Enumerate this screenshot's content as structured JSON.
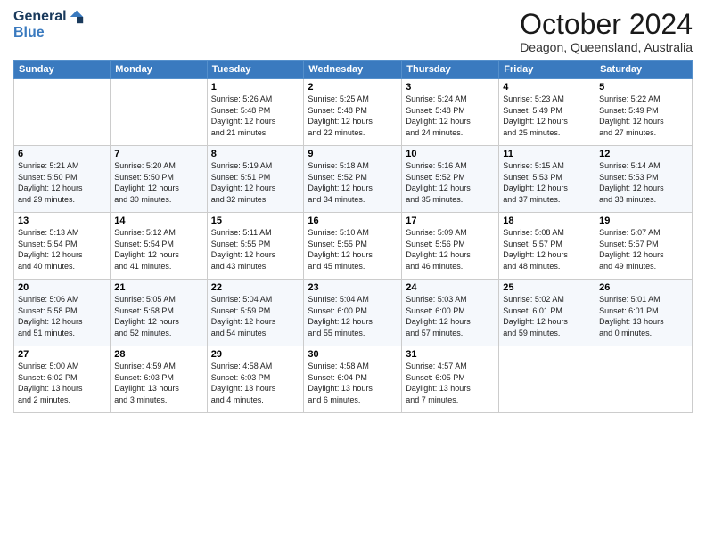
{
  "header": {
    "logo_general": "General",
    "logo_blue": "Blue",
    "month_title": "October 2024",
    "location": "Deagon, Queensland, Australia"
  },
  "days_of_week": [
    "Sunday",
    "Monday",
    "Tuesday",
    "Wednesday",
    "Thursday",
    "Friday",
    "Saturday"
  ],
  "weeks": [
    [
      {
        "day": "",
        "info": ""
      },
      {
        "day": "",
        "info": ""
      },
      {
        "day": "1",
        "info": "Sunrise: 5:26 AM\nSunset: 5:48 PM\nDaylight: 12 hours\nand 21 minutes."
      },
      {
        "day": "2",
        "info": "Sunrise: 5:25 AM\nSunset: 5:48 PM\nDaylight: 12 hours\nand 22 minutes."
      },
      {
        "day": "3",
        "info": "Sunrise: 5:24 AM\nSunset: 5:48 PM\nDaylight: 12 hours\nand 24 minutes."
      },
      {
        "day": "4",
        "info": "Sunrise: 5:23 AM\nSunset: 5:49 PM\nDaylight: 12 hours\nand 25 minutes."
      },
      {
        "day": "5",
        "info": "Sunrise: 5:22 AM\nSunset: 5:49 PM\nDaylight: 12 hours\nand 27 minutes."
      }
    ],
    [
      {
        "day": "6",
        "info": "Sunrise: 5:21 AM\nSunset: 5:50 PM\nDaylight: 12 hours\nand 29 minutes."
      },
      {
        "day": "7",
        "info": "Sunrise: 5:20 AM\nSunset: 5:50 PM\nDaylight: 12 hours\nand 30 minutes."
      },
      {
        "day": "8",
        "info": "Sunrise: 5:19 AM\nSunset: 5:51 PM\nDaylight: 12 hours\nand 32 minutes."
      },
      {
        "day": "9",
        "info": "Sunrise: 5:18 AM\nSunset: 5:52 PM\nDaylight: 12 hours\nand 34 minutes."
      },
      {
        "day": "10",
        "info": "Sunrise: 5:16 AM\nSunset: 5:52 PM\nDaylight: 12 hours\nand 35 minutes."
      },
      {
        "day": "11",
        "info": "Sunrise: 5:15 AM\nSunset: 5:53 PM\nDaylight: 12 hours\nand 37 minutes."
      },
      {
        "day": "12",
        "info": "Sunrise: 5:14 AM\nSunset: 5:53 PM\nDaylight: 12 hours\nand 38 minutes."
      }
    ],
    [
      {
        "day": "13",
        "info": "Sunrise: 5:13 AM\nSunset: 5:54 PM\nDaylight: 12 hours\nand 40 minutes."
      },
      {
        "day": "14",
        "info": "Sunrise: 5:12 AM\nSunset: 5:54 PM\nDaylight: 12 hours\nand 41 minutes."
      },
      {
        "day": "15",
        "info": "Sunrise: 5:11 AM\nSunset: 5:55 PM\nDaylight: 12 hours\nand 43 minutes."
      },
      {
        "day": "16",
        "info": "Sunrise: 5:10 AM\nSunset: 5:55 PM\nDaylight: 12 hours\nand 45 minutes."
      },
      {
        "day": "17",
        "info": "Sunrise: 5:09 AM\nSunset: 5:56 PM\nDaylight: 12 hours\nand 46 minutes."
      },
      {
        "day": "18",
        "info": "Sunrise: 5:08 AM\nSunset: 5:57 PM\nDaylight: 12 hours\nand 48 minutes."
      },
      {
        "day": "19",
        "info": "Sunrise: 5:07 AM\nSunset: 5:57 PM\nDaylight: 12 hours\nand 49 minutes."
      }
    ],
    [
      {
        "day": "20",
        "info": "Sunrise: 5:06 AM\nSunset: 5:58 PM\nDaylight: 12 hours\nand 51 minutes."
      },
      {
        "day": "21",
        "info": "Sunrise: 5:05 AM\nSunset: 5:58 PM\nDaylight: 12 hours\nand 52 minutes."
      },
      {
        "day": "22",
        "info": "Sunrise: 5:04 AM\nSunset: 5:59 PM\nDaylight: 12 hours\nand 54 minutes."
      },
      {
        "day": "23",
        "info": "Sunrise: 5:04 AM\nSunset: 6:00 PM\nDaylight: 12 hours\nand 55 minutes."
      },
      {
        "day": "24",
        "info": "Sunrise: 5:03 AM\nSunset: 6:00 PM\nDaylight: 12 hours\nand 57 minutes."
      },
      {
        "day": "25",
        "info": "Sunrise: 5:02 AM\nSunset: 6:01 PM\nDaylight: 12 hours\nand 59 minutes."
      },
      {
        "day": "26",
        "info": "Sunrise: 5:01 AM\nSunset: 6:01 PM\nDaylight: 13 hours\nand 0 minutes."
      }
    ],
    [
      {
        "day": "27",
        "info": "Sunrise: 5:00 AM\nSunset: 6:02 PM\nDaylight: 13 hours\nand 2 minutes."
      },
      {
        "day": "28",
        "info": "Sunrise: 4:59 AM\nSunset: 6:03 PM\nDaylight: 13 hours\nand 3 minutes."
      },
      {
        "day": "29",
        "info": "Sunrise: 4:58 AM\nSunset: 6:03 PM\nDaylight: 13 hours\nand 4 minutes."
      },
      {
        "day": "30",
        "info": "Sunrise: 4:58 AM\nSunset: 6:04 PM\nDaylight: 13 hours\nand 6 minutes."
      },
      {
        "day": "31",
        "info": "Sunrise: 4:57 AM\nSunset: 6:05 PM\nDaylight: 13 hours\nand 7 minutes."
      },
      {
        "day": "",
        "info": ""
      },
      {
        "day": "",
        "info": ""
      }
    ]
  ]
}
